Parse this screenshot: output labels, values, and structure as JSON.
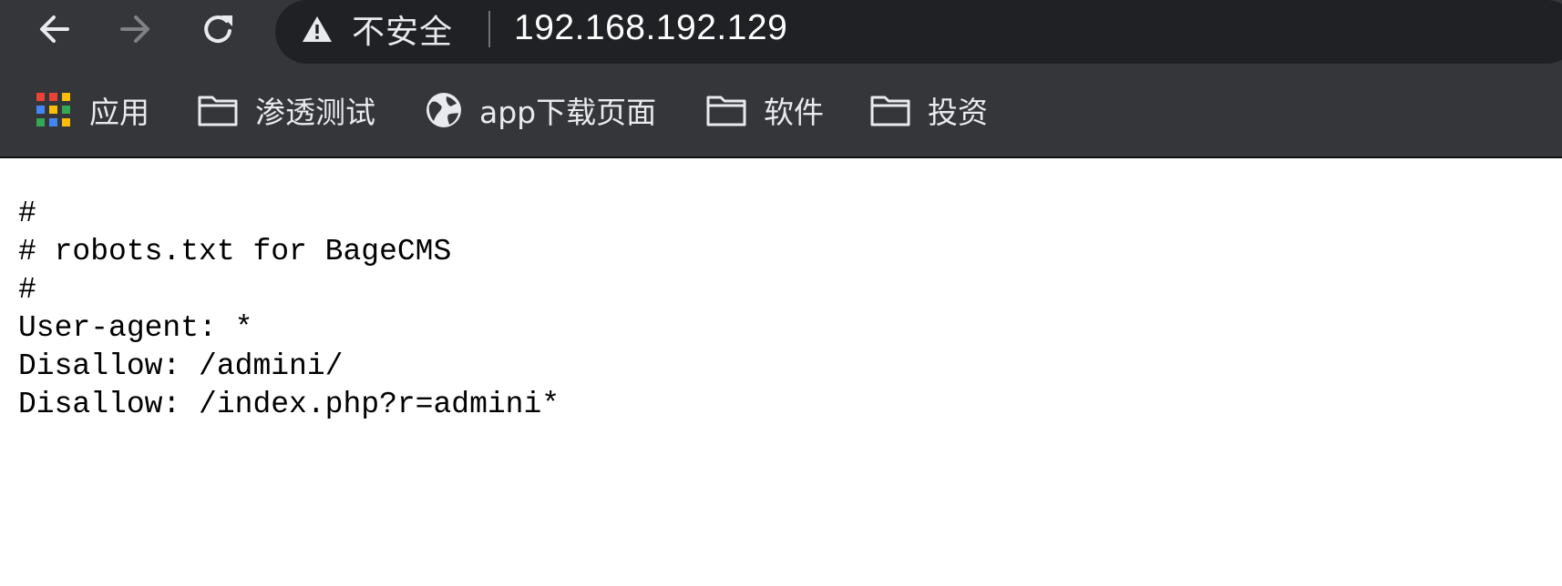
{
  "toolbar": {
    "back_icon": "arrow-left-icon",
    "forward_icon": "arrow-right-icon",
    "reload_icon": "reload-icon"
  },
  "omnibox": {
    "security_icon": "warning-triangle-icon",
    "security_label": "不安全",
    "url": "192.168.192.129"
  },
  "bookmarks": [
    {
      "label": "应用",
      "icon": "apps-grid-icon"
    },
    {
      "label": "渗透测试",
      "icon": "folder-icon"
    },
    {
      "label": "app下载页面",
      "icon": "globe-icon"
    },
    {
      "label": "软件",
      "icon": "folder-icon"
    },
    {
      "label": "投资",
      "icon": "folder-icon"
    }
  ],
  "colors": {
    "chrome_background": "#35363a",
    "omnibox_background": "#202124",
    "chrome_text": "#e8eaed",
    "page_background": "#ffffff",
    "page_text": "#000000"
  },
  "page": {
    "lines": [
      "#",
      "# robots.txt for BageCMS",
      "#",
      "User-agent: *",
      "Disallow: /admini/",
      "Disallow: /index.php?r=admini*"
    ]
  }
}
